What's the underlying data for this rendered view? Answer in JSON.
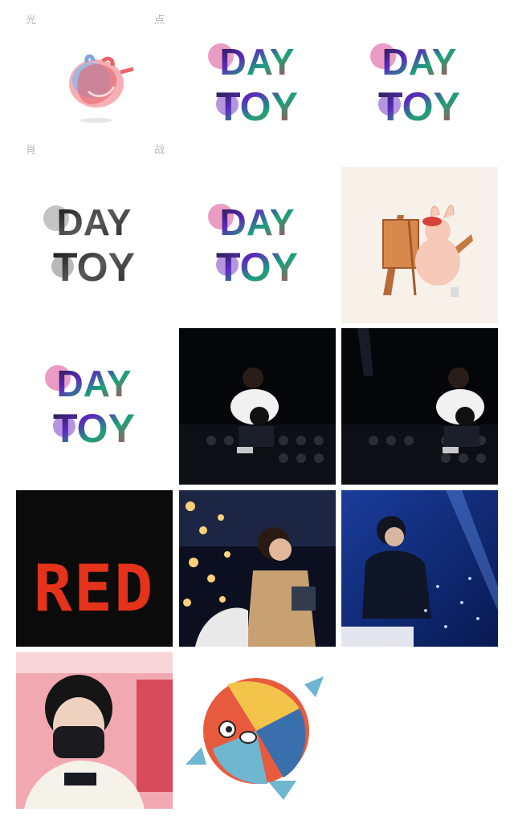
{
  "corner_text": {
    "top_left": "光",
    "top_right": "点",
    "bottom_left": "肖",
    "bottom_right": "战"
  },
  "tiles": [
    {
      "id": "t1",
      "word_top": "",
      "word_bottom": "",
      "subject": "heart illustration"
    },
    {
      "id": "t2",
      "word_top": "DAY",
      "word_bottom": "TOY",
      "subject": "colorful logo"
    },
    {
      "id": "t3",
      "word_top": "DAY",
      "word_bottom": "TOY",
      "subject": "colorful logo"
    },
    {
      "id": "t4",
      "word_top": "DAY",
      "word_bottom": "TOY",
      "subject": "grayscale logo"
    },
    {
      "id": "t5",
      "word_top": "DAY",
      "word_bottom": "TOY",
      "subject": "colorful logo"
    },
    {
      "id": "t6",
      "word_top": "",
      "word_bottom": "",
      "subject": "pig painting illustration"
    },
    {
      "id": "t7",
      "word_top": "DAY",
      "word_bottom": "TOY",
      "subject": "colorful logo"
    },
    {
      "id": "t8",
      "word_top": "",
      "word_bottom": "",
      "subject": "stage photo"
    },
    {
      "id": "t9",
      "word_top": "",
      "word_bottom": "",
      "subject": "stage photo"
    },
    {
      "id": "t10",
      "word_top": "RED",
      "word_bottom": "",
      "subject": "red title card"
    },
    {
      "id": "t11",
      "word_top": "",
      "word_bottom": "",
      "subject": "concert photo"
    },
    {
      "id": "t12",
      "word_top": "",
      "word_bottom": "",
      "subject": "blue stage photo"
    },
    {
      "id": "t13",
      "word_top": "",
      "word_bottom": "",
      "subject": "masked selfie"
    },
    {
      "id": "t14",
      "word_top": "",
      "word_bottom": "",
      "subject": "fish ball illustration"
    }
  ],
  "colors": {
    "bg": "#ffffff",
    "dark_stage": "#05060a",
    "red_text": "#e5321a",
    "blue_stage": "#0e2f86",
    "accent_purple": "#6b2bbf"
  }
}
